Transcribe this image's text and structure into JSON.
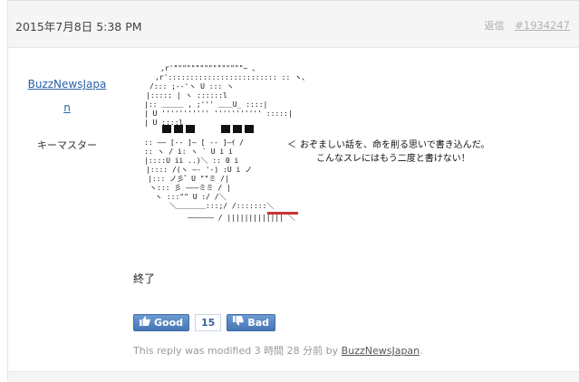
{
  "reply": {
    "date": "2015年7月8日 5:38 PM",
    "reply_label": "返信",
    "permalink": "#1934247"
  },
  "author": {
    "name": "BuzzNewsJapan",
    "role": "キーマスター"
  },
  "aa_caption_line1": "おぞましい話を、命を削る思いで書き込んだ。",
  "aa_caption_line2": "こんなスレにはもう二度と書けない！",
  "body_text": "終了",
  "vote": {
    "good_label": "Good",
    "count": "15",
    "bad_label": "Bad"
  },
  "modified": {
    "prefix": "This reply was modified 3 時間 28 分前 by",
    "by": "BuzzNewsJapan",
    "suffix": "."
  },
  "colors": {
    "link": "#2a63a8",
    "button": "#4677b6",
    "header_bg": "#f5f5f5"
  }
}
